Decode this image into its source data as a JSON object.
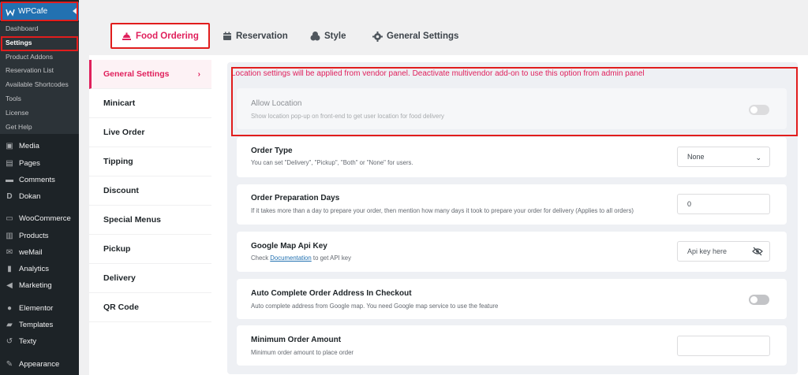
{
  "sidebar": {
    "plugin_title": "WPCafe",
    "submenu": [
      "Dashboard",
      "Settings",
      "Product Addons",
      "Reservation List",
      "Available Shortcodes",
      "Tools",
      "License",
      "Get Help"
    ],
    "menu": [
      {
        "label": "Media",
        "icon": "media-icon"
      },
      {
        "label": "Pages",
        "icon": "pages-icon"
      },
      {
        "label": "Comments",
        "icon": "comments-icon"
      },
      {
        "label": "Dokan",
        "icon": "dokan-icon"
      },
      {
        "label": "WooCommerce",
        "icon": "woocommerce-icon"
      },
      {
        "label": "Products",
        "icon": "products-icon"
      },
      {
        "label": "weMail",
        "icon": "wemail-icon"
      },
      {
        "label": "Analytics",
        "icon": "analytics-icon"
      },
      {
        "label": "Marketing",
        "icon": "marketing-icon"
      },
      {
        "label": "Elementor",
        "icon": "elementor-icon"
      },
      {
        "label": "Templates",
        "icon": "templates-icon"
      },
      {
        "label": "Texty",
        "icon": "texty-icon"
      },
      {
        "label": "Appearance",
        "icon": "appearance-icon"
      }
    ]
  },
  "tabs": [
    {
      "label": "Food Ordering",
      "icon": "food-tray-icon",
      "active": true
    },
    {
      "label": "Reservation",
      "icon": "calendar-icon",
      "active": false
    },
    {
      "label": "Style",
      "icon": "palette-icon",
      "active": false
    },
    {
      "label": "General Settings",
      "icon": "gear-icon",
      "active": false
    }
  ],
  "vmenu": [
    "General Settings",
    "Minicart",
    "Live Order",
    "Tipping",
    "Discount",
    "Special Menus",
    "Pickup",
    "Delivery",
    "QR Code"
  ],
  "notice": "Location settings will be applied from vendor panel. Deactivate multivendor add-on to use this option from admin panel",
  "settings": {
    "allow_location": {
      "title": "Allow Location",
      "desc": "Show location pop-up on front-end to get user location for food delivery",
      "enabled": false
    },
    "order_type": {
      "title": "Order Type",
      "desc": "You can set \"Delivery\", \"Pickup\", \"Both\" or \"None\" for users.",
      "value": "None"
    },
    "prep_days": {
      "title": "Order Preparation Days",
      "desc": "If it takes more than a day to prepare your order, then mention how many days it took to prepare your order for delivery (Applies to all orders)",
      "value": "0"
    },
    "api_key": {
      "title": "Google Map Api Key",
      "desc_before": "Check",
      "desc_link": "Documentation",
      "desc_after": "to get API key",
      "placeholder": "Api key here"
    },
    "auto_complete": {
      "title": "Auto Complete Order Address In Checkout",
      "desc": "Auto complete address from Google map. You need Google map service to use the feature",
      "enabled": false
    },
    "min_amount": {
      "title": "Minimum Order Amount",
      "desc": "Minimum order amount to place order",
      "value": ""
    }
  },
  "colors": {
    "accent": "#e0205c",
    "wp_blue": "#2271b1",
    "sidebar": "#1d2327",
    "highlight_border": "#e11d1d"
  }
}
